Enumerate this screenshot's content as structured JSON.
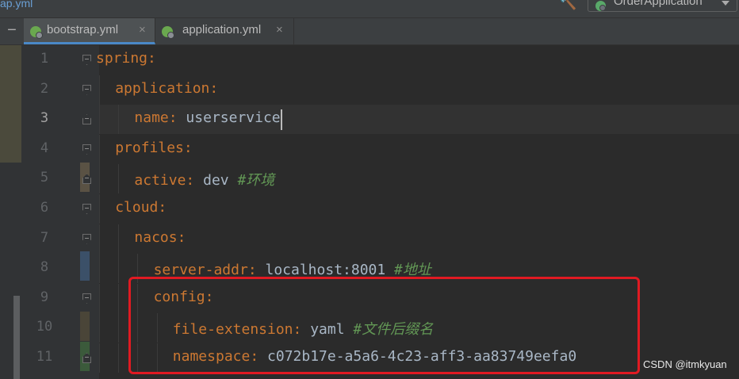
{
  "topbar": {
    "breadcrumb": "ap.yml",
    "run_config": "OrderApplication"
  },
  "tabs": [
    {
      "label": "bootstrap.yml",
      "close": "×",
      "active": true
    },
    {
      "label": "application.yml",
      "close": "×",
      "active": false
    }
  ],
  "editor": {
    "lines": [
      {
        "num": "1",
        "indent": 0,
        "key": "spring",
        "colon": ":",
        "value": "",
        "comment": "",
        "fold": "open"
      },
      {
        "num": "2",
        "indent": 1,
        "key": "application",
        "colon": ":",
        "value": "",
        "comment": "",
        "fold": "open"
      },
      {
        "num": "3",
        "indent": 2,
        "key": "name",
        "colon": ":",
        "value": " userservice",
        "comment": "",
        "fold": "close",
        "current": true
      },
      {
        "num": "4",
        "indent": 1,
        "key": "profiles",
        "colon": ":",
        "value": "",
        "comment": "",
        "fold": "open"
      },
      {
        "num": "5",
        "indent": 2,
        "key": "active",
        "colon": ":",
        "value": " dev ",
        "comment": "#环境",
        "fold": "close"
      },
      {
        "num": "6",
        "indent": 1,
        "key": "cloud",
        "colon": ":",
        "value": "",
        "comment": "",
        "fold": "open"
      },
      {
        "num": "7",
        "indent": 2,
        "key": "nacos",
        "colon": ":",
        "value": "",
        "comment": "",
        "fold": "open"
      },
      {
        "num": "8",
        "indent": 3,
        "key": "server-addr",
        "colon": ":",
        "value": " localhost:8001 ",
        "comment": "#地址",
        "fold": ""
      },
      {
        "num": "9",
        "indent": 3,
        "key": "config",
        "colon": ":",
        "value": "",
        "comment": "",
        "fold": "open"
      },
      {
        "num": "10",
        "indent": 4,
        "key": "file-extension",
        "colon": ":",
        "value": " yaml ",
        "comment": "#文件后缀名",
        "fold": ""
      },
      {
        "num": "11",
        "indent": 4,
        "key": "namespace",
        "colon": ":",
        "value": " c072b17e-a5a6-4c23-aff3-aa83749eefa0",
        "comment": "",
        "fold": "close"
      }
    ]
  },
  "watermark": "CSDN @itmkyuan",
  "colors": {
    "key": "#cc7832",
    "value": "#a9b7c6",
    "comment": "#629755",
    "highlight_border": "#e01a22"
  }
}
